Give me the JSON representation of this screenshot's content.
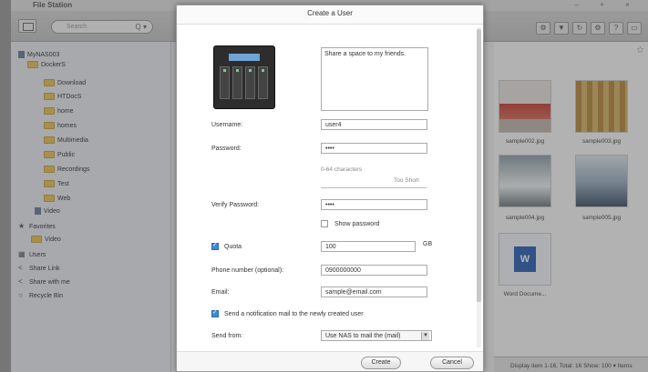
{
  "app": {
    "title": "File Station",
    "window_controls": [
      "–",
      "+",
      "×"
    ]
  },
  "toolbar": {
    "search_placeholder": "Search",
    "search_icon": "Q ▾",
    "icons": [
      "⚙",
      "▼",
      "↻",
      "⚙",
      "?",
      "▭"
    ]
  },
  "sidebar": {
    "items": [
      {
        "label": "MyNAS003",
        "type": "nas"
      },
      {
        "label": "DockerS",
        "type": "folder"
      },
      {
        "label": "Download",
        "type": "folder"
      },
      {
        "label": "HTDocS",
        "type": "folder"
      },
      {
        "label": "home",
        "type": "folder"
      },
      {
        "label": "homes",
        "type": "folder"
      },
      {
        "label": "Multimedia",
        "type": "folder"
      },
      {
        "label": "Public",
        "type": "folder"
      },
      {
        "label": "Recordings",
        "type": "folder"
      },
      {
        "label": "Test",
        "type": "folder"
      },
      {
        "label": "Web",
        "type": "folder"
      },
      {
        "label": "Video",
        "type": "folder"
      },
      {
        "label": "Favorites",
        "type": "star"
      },
      {
        "label": "Video",
        "type": "folder"
      },
      {
        "label": "Users",
        "type": "users"
      },
      {
        "label": "Share Link",
        "type": "share"
      },
      {
        "label": "Share with me",
        "type": "share"
      },
      {
        "label": "Recycle Bin",
        "type": "recycle"
      }
    ]
  },
  "content": {
    "files": [
      {
        "name": "sample002.jpg"
      },
      {
        "name": "sample003.jpg"
      },
      {
        "name": "sample004.jpg"
      },
      {
        "name": "sample005.jpg"
      },
      {
        "name": "Word Docume..."
      }
    ],
    "status": "Display item 1-16, Total: 16   Show: 100 ▾ Items"
  },
  "dialog": {
    "title": "Create a User",
    "description": "Share a space to my friends.",
    "username_label": "Username:",
    "username_value": "user4",
    "password_label": "Password:",
    "password_value": "••••",
    "password_hint": "0-64 characters",
    "password_strength": "Too Short",
    "verify_label": "Verify Password:",
    "verify_value": "••••",
    "show_password_label": "Show password",
    "quota_label": "Quota",
    "quota_value": "100",
    "quota_unit": "GB",
    "phone_label": "Phone number (optional):",
    "phone_value": "0900000000",
    "email_label": "Email:",
    "email_value": "sample@email.com",
    "notify_label": "Send a notification mail to the newly created user",
    "send_from_label": "Send from:",
    "send_from_value": "Use NAS to mail the (mail)",
    "create_label": "Create",
    "cancel_label": "Cancel"
  }
}
